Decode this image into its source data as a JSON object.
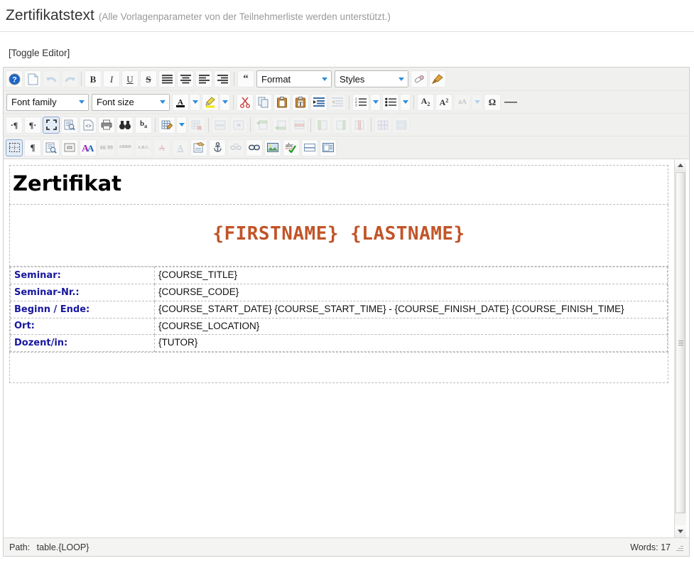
{
  "header": {
    "title": "Zertifikatstext",
    "subtitle": "(Alle Vorlagenparameter von der Teilnehmerliste werden unterstützt.)"
  },
  "toggle_editor": {
    "label": "[Toggle Editor]"
  },
  "toolbar": {
    "row1": [
      {
        "name": "about-icon",
        "glyph": "?",
        "type": "round-help"
      },
      {
        "name": "new-document-icon",
        "glyph": "",
        "type": "page"
      },
      {
        "name": "undo-icon",
        "glyph": "↺",
        "type": "undo",
        "disabled": true
      },
      {
        "name": "redo-icon",
        "glyph": "↻",
        "type": "redo",
        "disabled": true
      },
      {
        "sep": true
      },
      {
        "name": "bold-icon",
        "glyph": "B",
        "type": "bold"
      },
      {
        "name": "italic-icon",
        "glyph": "I",
        "type": "italic"
      },
      {
        "name": "underline-icon",
        "glyph": "U",
        "type": "underline"
      },
      {
        "name": "strikethrough-icon",
        "glyph": "S",
        "type": "strike"
      },
      {
        "name": "align-justify-icon",
        "glyph": "",
        "type": "lines-justify"
      },
      {
        "name": "align-center-icon",
        "glyph": "",
        "type": "lines-center"
      },
      {
        "name": "align-left-icon",
        "glyph": "",
        "type": "lines-left"
      },
      {
        "name": "align-right-icon",
        "glyph": "",
        "type": "lines-right"
      },
      {
        "sep": true
      },
      {
        "name": "blockquote-icon",
        "glyph": "“",
        "type": "quote"
      }
    ],
    "format_select": {
      "name": "format-select",
      "value": "Format"
    },
    "styles_select": {
      "name": "styles-select",
      "value": "Styles"
    },
    "row1_end": [
      {
        "name": "remove-format-icon",
        "type": "eraser"
      },
      {
        "name": "paint-format-icon",
        "type": "brush"
      }
    ],
    "font_family_select": {
      "name": "font-family-select",
      "value": "Font family"
    },
    "font_size_select": {
      "name": "font-size-select",
      "value": "Font size"
    },
    "row2": [
      {
        "name": "text-color-icon",
        "type": "text-color"
      },
      {
        "name": "text-color-dropdown",
        "type": "arrow"
      },
      {
        "name": "highlight-color-icon",
        "type": "highlight"
      },
      {
        "name": "highlight-color-dropdown",
        "type": "arrow"
      },
      {
        "sep": true
      },
      {
        "name": "cut-icon",
        "type": "scissors"
      },
      {
        "name": "copy-icon",
        "type": "copy"
      },
      {
        "name": "paste-icon",
        "type": "clipboard"
      },
      {
        "name": "paste-as-text-icon",
        "type": "clipboard-t"
      },
      {
        "name": "indent-increase-icon",
        "type": "indent-in"
      },
      {
        "name": "indent-decrease-icon",
        "type": "indent-out",
        "disabled": true
      },
      {
        "sep": true
      },
      {
        "name": "numbered-list-icon",
        "type": "ol"
      },
      {
        "name": "numbered-list-dropdown",
        "type": "arrow"
      },
      {
        "name": "bulleted-list-icon",
        "type": "ul"
      },
      {
        "name": "bulleted-list-dropdown",
        "type": "arrow"
      },
      {
        "sep": true
      },
      {
        "name": "subscript-icon",
        "glyph": "A₂",
        "type": "glyph"
      },
      {
        "name": "superscript-icon",
        "glyph": "A²",
        "type": "glyph"
      },
      {
        "name": "change-case-icon",
        "glyph": "aA",
        "type": "glyph",
        "disabled": true
      },
      {
        "name": "change-case-dropdown",
        "type": "arrow",
        "disabled": true
      },
      {
        "name": "special-character-icon",
        "glyph": "Ω",
        "type": "glyph"
      },
      {
        "name": "horizontal-rule-icon",
        "type": "hr"
      }
    ],
    "row3": [
      {
        "name": "ltr-direction-icon",
        "glyph": "·¶",
        "type": "glyph"
      },
      {
        "name": "rtl-direction-icon",
        "glyph": "¶·",
        "type": "glyph"
      },
      {
        "name": "fullscreen-icon",
        "type": "fullscreen",
        "active": true
      },
      {
        "name": "preview-icon",
        "type": "preview"
      },
      {
        "name": "source-code-icon",
        "glyph": "<>",
        "type": "code"
      },
      {
        "name": "print-icon",
        "type": "printer"
      },
      {
        "name": "search-icon",
        "type": "binoculars"
      },
      {
        "name": "search-replace-icon",
        "glyph": "ba",
        "type": "glyph"
      },
      {
        "sep": true
      },
      {
        "name": "table-icon",
        "type": "table-edit"
      },
      {
        "name": "table-dropdown",
        "type": "arrow"
      },
      {
        "name": "delete-table-icon",
        "type": "table-del",
        "disabled": true
      },
      {
        "sep": true
      },
      {
        "name": "table-row-properties-icon",
        "type": "table-rowprop",
        "disabled": true
      },
      {
        "name": "table-cell-properties-icon",
        "type": "table-cellprop",
        "disabled": true
      },
      {
        "sep": true
      },
      {
        "name": "insert-row-before-icon",
        "type": "row-before",
        "disabled": true
      },
      {
        "name": "insert-row-after-icon",
        "type": "row-after",
        "disabled": true
      },
      {
        "name": "delete-row-icon",
        "type": "row-del",
        "disabled": true
      },
      {
        "sep": true
      },
      {
        "name": "insert-column-before-icon",
        "type": "col-before",
        "disabled": true
      },
      {
        "name": "insert-column-after-icon",
        "type": "col-after",
        "disabled": true
      },
      {
        "name": "delete-column-icon",
        "type": "col-del",
        "disabled": true
      },
      {
        "sep": true
      },
      {
        "name": "split-cells-icon",
        "type": "split",
        "disabled": true
      },
      {
        "name": "merge-cells-icon",
        "type": "merge",
        "disabled": true
      }
    ],
    "row4": [
      {
        "name": "show-borders-icon",
        "type": "borders",
        "active": true
      },
      {
        "name": "show-invisible-characters-icon",
        "glyph": "¶",
        "type": "glyph"
      },
      {
        "name": "template-icon",
        "type": "template"
      },
      {
        "name": "page-break-icon",
        "type": "pagebreak"
      },
      {
        "name": "styles-format-icon",
        "type": "aa"
      },
      {
        "name": "citation-icon",
        "glyph": "66 99",
        "type": "tiny",
        "disabled": true
      },
      {
        "name": "abbreviation-icon",
        "glyph": "ABBR",
        "type": "tiny",
        "disabled": true
      },
      {
        "name": "acronym-icon",
        "glyph": "A.B.C.",
        "type": "tiny",
        "disabled": true
      },
      {
        "name": "delete-text-icon",
        "glyph": "A",
        "type": "strike-a",
        "disabled": true
      },
      {
        "name": "insert-text-icon",
        "glyph": "A",
        "type": "under-a",
        "disabled": true
      },
      {
        "name": "insert-note-icon",
        "type": "note"
      },
      {
        "name": "anchor-icon",
        "type": "anchor"
      },
      {
        "name": "unlink-icon",
        "type": "unlink",
        "disabled": true
      },
      {
        "name": "link-icon",
        "type": "link"
      },
      {
        "name": "insert-image-icon",
        "type": "image"
      },
      {
        "name": "spellcheck-icon",
        "glyph": "abc",
        "type": "spell"
      },
      {
        "name": "insert-horizontal-rule-icon",
        "type": "hline"
      },
      {
        "name": "insert-layer-icon",
        "type": "layer"
      }
    ]
  },
  "document": {
    "title": "Zertifikat",
    "name_line": "{FIRSTNAME} {LASTNAME}",
    "rows": [
      {
        "label": "Seminar:",
        "value": "{COURSE_TITLE}"
      },
      {
        "label": "Seminar-Nr.:",
        "value": "{COURSE_CODE}"
      },
      {
        "label": "Beginn / Ende:",
        "value": "{COURSE_START_DATE} {COURSE_START_TIME} - {COURSE_FINISH_DATE} {COURSE_FINISH_TIME}"
      },
      {
        "label": "Ort:",
        "value": "{COURSE_LOCATION}"
      },
      {
        "label": "Dozent/in:",
        "value": "{TUTOR}"
      }
    ],
    "empty_row": ""
  },
  "status": {
    "path_label": "Path:",
    "path_value": "table.{LOOP}",
    "words": "Words: 17"
  },
  "colors": {
    "title_color": "#000000",
    "name_color": "#c15428",
    "label_color": "#17179e",
    "toolbar_bg": "#f0f0ef",
    "accent_blue": "#2b8ede"
  }
}
